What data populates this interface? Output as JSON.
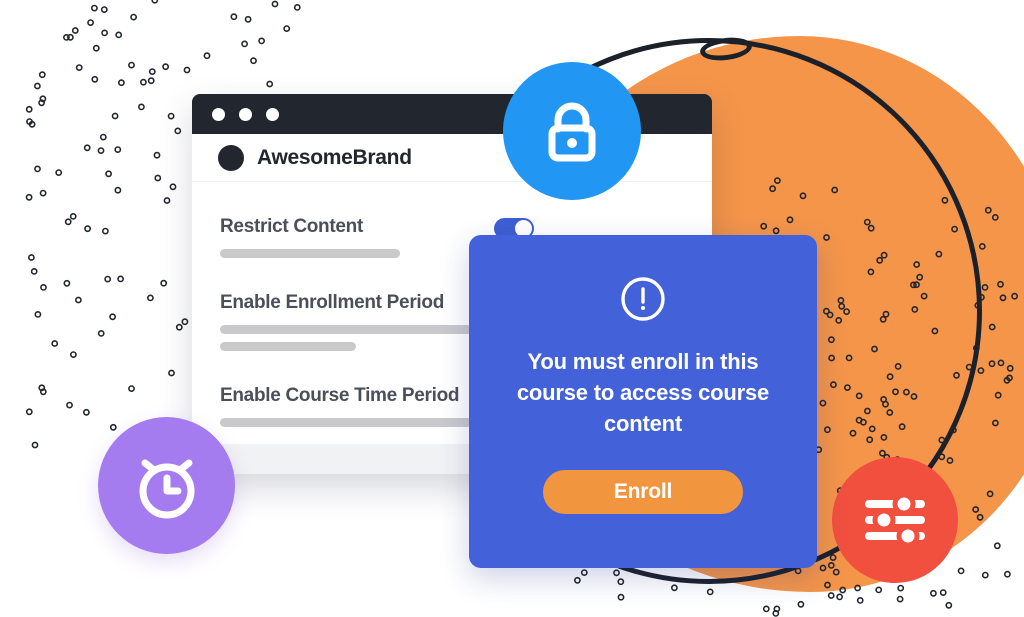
{
  "scene": {
    "title": "Course content restriction illustration"
  },
  "browser": {
    "window_dots": [
      "dot-1",
      "dot-2",
      "dot-3"
    ],
    "brand": {
      "logo_icon": "circle-logo-icon",
      "name": "AwesomeBrand"
    },
    "settings": [
      {
        "label": "Restrict Content",
        "toggle_state": "on",
        "has_toggle": true,
        "bars": [
          "long"
        ]
      },
      {
        "label": "Enable Enrollment Period",
        "toggle_state": "",
        "has_toggle": false,
        "bars": [
          "xl",
          "mid"
        ]
      },
      {
        "label": "Enable Course Time Period",
        "toggle_state": "",
        "has_toggle": false,
        "bars": [
          "xl"
        ]
      }
    ]
  },
  "badges": [
    {
      "name": "lock-badge",
      "icon": "lock-icon",
      "color": "#2196F3"
    },
    {
      "name": "alarm-clock-badge",
      "icon": "alarm-clock-icon",
      "color": "#A57CF0"
    },
    {
      "name": "sliders-badge",
      "icon": "sliders-icon",
      "color": "#F2503F"
    }
  ],
  "modal": {
    "icon": "alert-circle-icon",
    "message": "You must enroll in this course to access course content",
    "button_label": "Enroll",
    "background_color": "#4361D8",
    "button_color": "#F2953F"
  },
  "decor": {
    "orange_blob_color": "#F4954A",
    "ring_color": "#1B2029",
    "dot_color": "#22262E"
  }
}
